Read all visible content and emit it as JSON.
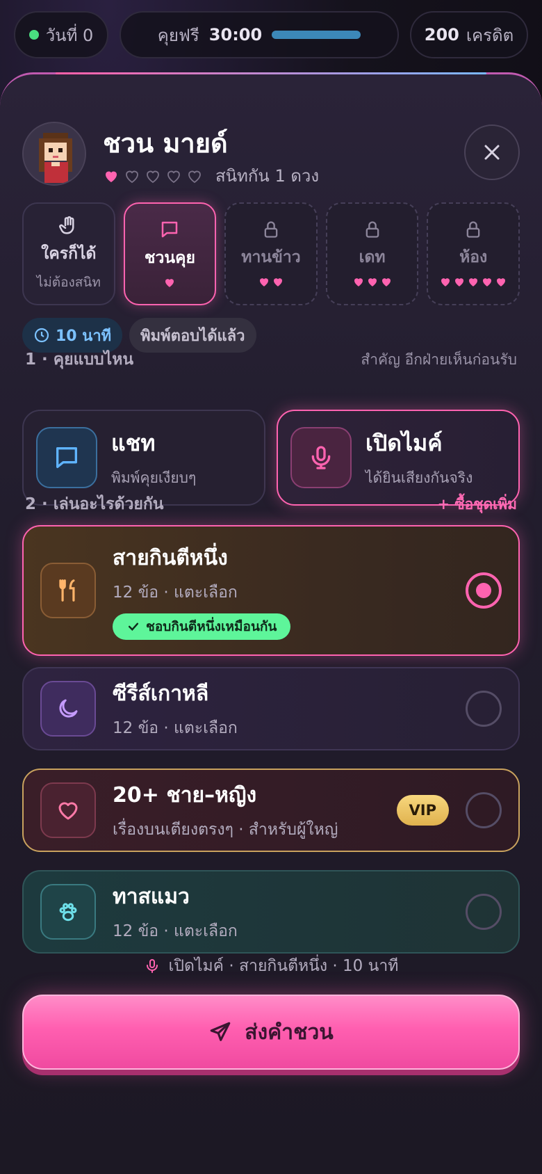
{
  "status": {
    "day_label": "วันที่ 0",
    "free_label": "คุยฟรี",
    "free_time": "30:00",
    "free_progress": 0.85,
    "credits_value": "200",
    "credits_label": "เครดิต"
  },
  "profile": {
    "name": "ชวน มายด์",
    "hearts_filled": 1,
    "hearts_total": 5,
    "affinity_label": "สนิทกัน 1 ดวง"
  },
  "invite_types": [
    {
      "label": "ใครก็ได้",
      "sub": "ไม่ต้องสนิท",
      "icon": "hand-icon",
      "state": "normal",
      "hearts": 0
    },
    {
      "label": "ชวนคุย",
      "sub": "",
      "icon": "chat-icon",
      "state": "active",
      "hearts": 1
    },
    {
      "label": "ทานข้าว",
      "sub": "",
      "icon": "lock-icon",
      "state": "locked",
      "hearts": 2
    },
    {
      "label": "เดท",
      "sub": "",
      "icon": "lock-icon",
      "state": "locked",
      "hearts": 3
    },
    {
      "label": "ห้อง",
      "sub": "",
      "icon": "lock-icon",
      "state": "locked",
      "hearts": 5
    }
  ],
  "chips": {
    "duration": "10 นาที",
    "reply_type": "พิมพ์ตอบได้แล้ว"
  },
  "section1": {
    "title": "1 · คุยแบบไหน",
    "note": "สำคัญ อีกฝ่ายเห็นก่อนรับ"
  },
  "modes": [
    {
      "title": "แชท",
      "sub": "พิมพ์คุยเงียบๆ",
      "icon": "chat-icon",
      "active": false
    },
    {
      "title": "เปิดไมค์",
      "sub": "ได้ยินเสียงกันจริง",
      "icon": "mic-icon",
      "active": true
    }
  ],
  "section2": {
    "title": "2 · เล่นอะไรด้วยกัน",
    "buy_more": "+ ซื้อชุดเพิ่ม"
  },
  "topics": [
    {
      "title": "สายกินตีหนึ่ง",
      "sub": "12 ข้อ · แตะเลือก",
      "badge": "ชอบกินตีหนึ่งเหมือนกัน",
      "icon": "utensils-icon",
      "selected": true
    },
    {
      "title": "ซีรีส์เกาหลี",
      "sub": "12 ข้อ · แตะเลือก",
      "icon": "moon-icon",
      "selected": false
    },
    {
      "title": "20+ ชาย–หญิง",
      "sub": "เรื่องบนเตียงตรงๆ · สำหรับผู้ใหญ่",
      "vip": "VIP",
      "icon": "heart-icon",
      "selected": false
    },
    {
      "title": "ทาสแมว",
      "sub": "12 ข้อ · แตะเลือก",
      "icon": "paw-icon",
      "selected": false
    }
  ],
  "summary": "เปิดไมค์ · สายกินตีหนึ่ง · 10 นาที",
  "cta_label": "ส่งคำชวน",
  "colors": {
    "accent_pink": "#ff63b0",
    "accent_blue": "#7cc2ff",
    "match_green": "#5ef59a",
    "vip_gold": "#e0b24e"
  }
}
